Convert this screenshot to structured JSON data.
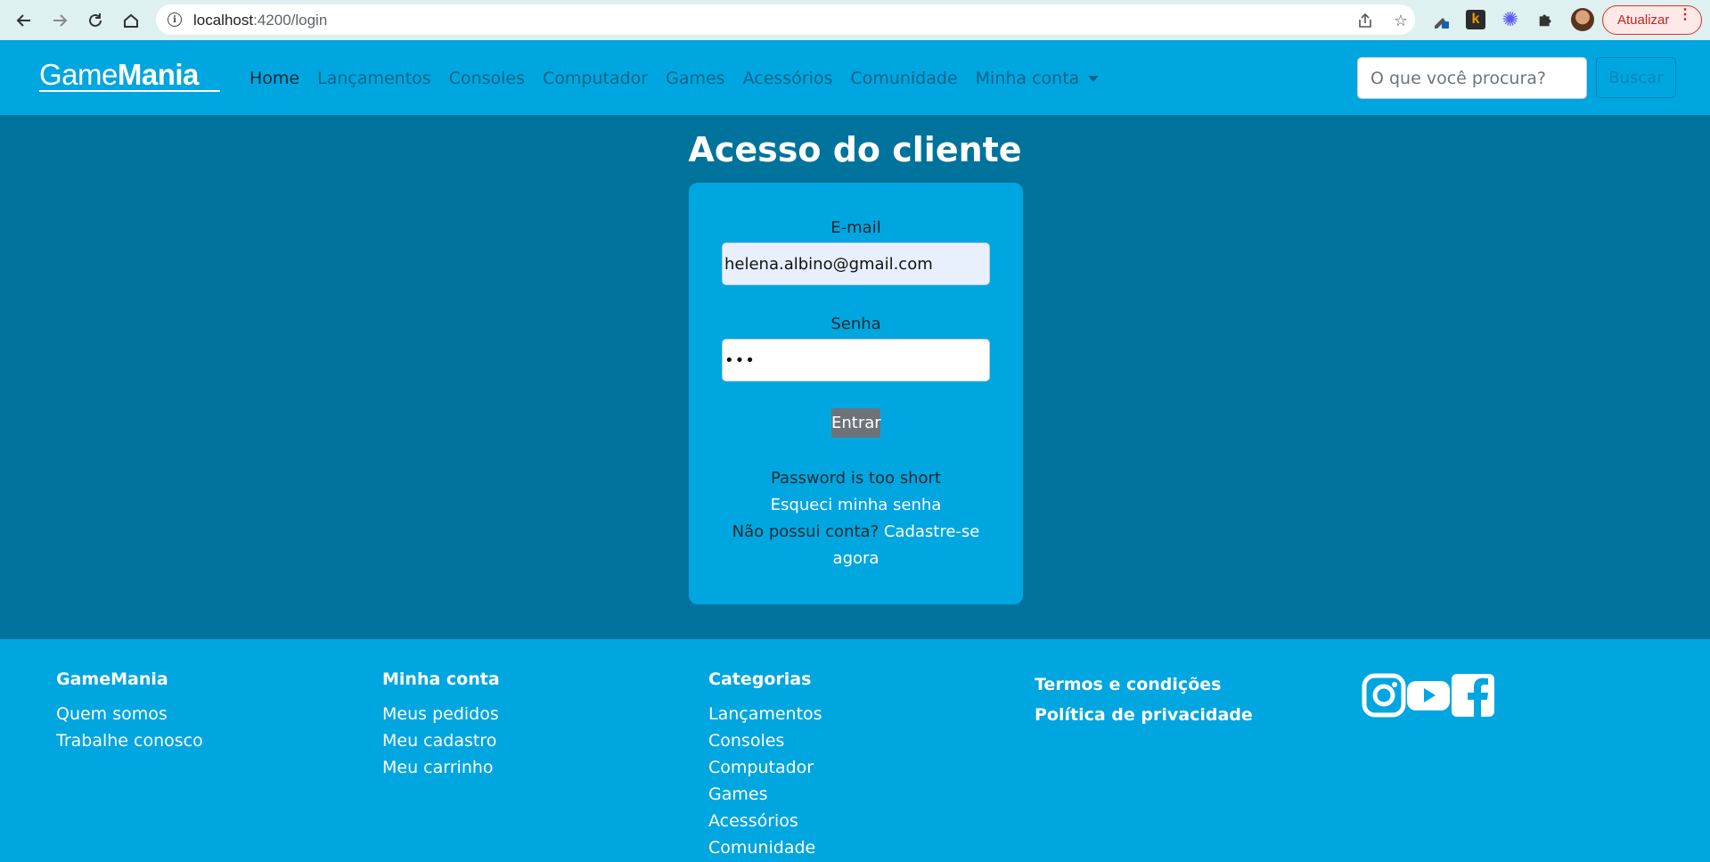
{
  "browser": {
    "url_host": "localhost",
    "url_path": ":4200/login",
    "update_label": "Atualizar"
  },
  "navbar": {
    "logo_light": "Game",
    "logo_bold": "Mania",
    "links": [
      {
        "label": "Home"
      },
      {
        "label": "Lançamentos"
      },
      {
        "label": "Consoles"
      },
      {
        "label": "Computador"
      },
      {
        "label": "Games"
      },
      {
        "label": "Acessórios"
      },
      {
        "label": "Comunidade"
      },
      {
        "label": "Minha conta"
      }
    ],
    "search_placeholder": "O que você procura?",
    "search_button": "Buscar"
  },
  "login": {
    "title": "Acesso do cliente",
    "email_label": "E-mail",
    "email_value": "helena.albino@gmail.com",
    "password_label": "Senha",
    "password_value": "•••",
    "submit_label": "Entrar",
    "error_message": "Password is too short",
    "forgot_link": "Esqueci minha senha",
    "signup_prompt": "Não possui conta?",
    "signup_link_1": "Cadastre-se",
    "signup_link_2": "agora"
  },
  "footer": {
    "col1": {
      "heading": "GameMania",
      "links": [
        "Quem somos",
        "Trabalhe conosco"
      ]
    },
    "col2": {
      "heading": "Minha conta",
      "links": [
        "Meus pedidos",
        "Meu cadastro",
        "Meu carrinho"
      ]
    },
    "col3": {
      "heading": "Categorias",
      "links": [
        "Lançamentos",
        "Consoles",
        "Computador",
        "Games",
        "Acessórios",
        "Comunidade"
      ]
    },
    "col4": {
      "links": [
        "Termos e condições",
        "Política de privacidade"
      ]
    },
    "social_icons": [
      "instagram-icon",
      "youtube-icon",
      "facebook-icon"
    ]
  },
  "colors": {
    "page_bg": "#00739c",
    "nav_bg": "#00a6e0",
    "nav_link": "#00658a",
    "button_gray": "#6c7479"
  }
}
